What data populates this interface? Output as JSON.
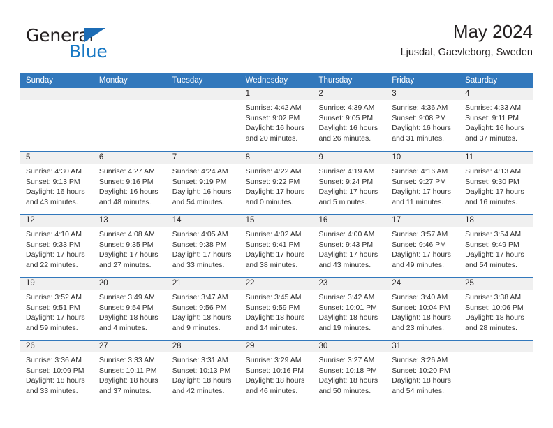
{
  "brand": {
    "name_part1": "General",
    "name_part2": "Blue",
    "triangle_color": "#1c6cb5",
    "blue_color": "#1878c4"
  },
  "header": {
    "title": "May 2024",
    "location": "Ljusdal, Gaevleborg, Sweden"
  },
  "theme": {
    "header_band": "#3278bc",
    "day_band": "#f0f0f0",
    "text": "#231f20"
  },
  "weekdays": [
    "Sunday",
    "Monday",
    "Tuesday",
    "Wednesday",
    "Thursday",
    "Friday",
    "Saturday"
  ],
  "weeks": [
    [
      {
        "day": "",
        "empty": true
      },
      {
        "day": "",
        "empty": true
      },
      {
        "day": "",
        "empty": true
      },
      {
        "day": "1",
        "sunrise": "Sunrise: 4:42 AM",
        "sunset": "Sunset: 9:02 PM",
        "daylight_line1": "Daylight: 16 hours",
        "daylight_line2": "and 20 minutes."
      },
      {
        "day": "2",
        "sunrise": "Sunrise: 4:39 AM",
        "sunset": "Sunset: 9:05 PM",
        "daylight_line1": "Daylight: 16 hours",
        "daylight_line2": "and 26 minutes."
      },
      {
        "day": "3",
        "sunrise": "Sunrise: 4:36 AM",
        "sunset": "Sunset: 9:08 PM",
        "daylight_line1": "Daylight: 16 hours",
        "daylight_line2": "and 31 minutes."
      },
      {
        "day": "4",
        "sunrise": "Sunrise: 4:33 AM",
        "sunset": "Sunset: 9:11 PM",
        "daylight_line1": "Daylight: 16 hours",
        "daylight_line2": "and 37 minutes."
      }
    ],
    [
      {
        "day": "5",
        "sunrise": "Sunrise: 4:30 AM",
        "sunset": "Sunset: 9:13 PM",
        "daylight_line1": "Daylight: 16 hours",
        "daylight_line2": "and 43 minutes."
      },
      {
        "day": "6",
        "sunrise": "Sunrise: 4:27 AM",
        "sunset": "Sunset: 9:16 PM",
        "daylight_line1": "Daylight: 16 hours",
        "daylight_line2": "and 48 minutes."
      },
      {
        "day": "7",
        "sunrise": "Sunrise: 4:24 AM",
        "sunset": "Sunset: 9:19 PM",
        "daylight_line1": "Daylight: 16 hours",
        "daylight_line2": "and 54 minutes."
      },
      {
        "day": "8",
        "sunrise": "Sunrise: 4:22 AM",
        "sunset": "Sunset: 9:22 PM",
        "daylight_line1": "Daylight: 17 hours",
        "daylight_line2": "and 0 minutes."
      },
      {
        "day": "9",
        "sunrise": "Sunrise: 4:19 AM",
        "sunset": "Sunset: 9:24 PM",
        "daylight_line1": "Daylight: 17 hours",
        "daylight_line2": "and 5 minutes."
      },
      {
        "day": "10",
        "sunrise": "Sunrise: 4:16 AM",
        "sunset": "Sunset: 9:27 PM",
        "daylight_line1": "Daylight: 17 hours",
        "daylight_line2": "and 11 minutes."
      },
      {
        "day": "11",
        "sunrise": "Sunrise: 4:13 AM",
        "sunset": "Sunset: 9:30 PM",
        "daylight_line1": "Daylight: 17 hours",
        "daylight_line2": "and 16 minutes."
      }
    ],
    [
      {
        "day": "12",
        "sunrise": "Sunrise: 4:10 AM",
        "sunset": "Sunset: 9:33 PM",
        "daylight_line1": "Daylight: 17 hours",
        "daylight_line2": "and 22 minutes."
      },
      {
        "day": "13",
        "sunrise": "Sunrise: 4:08 AM",
        "sunset": "Sunset: 9:35 PM",
        "daylight_line1": "Daylight: 17 hours",
        "daylight_line2": "and 27 minutes."
      },
      {
        "day": "14",
        "sunrise": "Sunrise: 4:05 AM",
        "sunset": "Sunset: 9:38 PM",
        "daylight_line1": "Daylight: 17 hours",
        "daylight_line2": "and 33 minutes."
      },
      {
        "day": "15",
        "sunrise": "Sunrise: 4:02 AM",
        "sunset": "Sunset: 9:41 PM",
        "daylight_line1": "Daylight: 17 hours",
        "daylight_line2": "and 38 minutes."
      },
      {
        "day": "16",
        "sunrise": "Sunrise: 4:00 AM",
        "sunset": "Sunset: 9:43 PM",
        "daylight_line1": "Daylight: 17 hours",
        "daylight_line2": "and 43 minutes."
      },
      {
        "day": "17",
        "sunrise": "Sunrise: 3:57 AM",
        "sunset": "Sunset: 9:46 PM",
        "daylight_line1": "Daylight: 17 hours",
        "daylight_line2": "and 49 minutes."
      },
      {
        "day": "18",
        "sunrise": "Sunrise: 3:54 AM",
        "sunset": "Sunset: 9:49 PM",
        "daylight_line1": "Daylight: 17 hours",
        "daylight_line2": "and 54 minutes."
      }
    ],
    [
      {
        "day": "19",
        "sunrise": "Sunrise: 3:52 AM",
        "sunset": "Sunset: 9:51 PM",
        "daylight_line1": "Daylight: 17 hours",
        "daylight_line2": "and 59 minutes."
      },
      {
        "day": "20",
        "sunrise": "Sunrise: 3:49 AM",
        "sunset": "Sunset: 9:54 PM",
        "daylight_line1": "Daylight: 18 hours",
        "daylight_line2": "and 4 minutes."
      },
      {
        "day": "21",
        "sunrise": "Sunrise: 3:47 AM",
        "sunset": "Sunset: 9:56 PM",
        "daylight_line1": "Daylight: 18 hours",
        "daylight_line2": "and 9 minutes."
      },
      {
        "day": "22",
        "sunrise": "Sunrise: 3:45 AM",
        "sunset": "Sunset: 9:59 PM",
        "daylight_line1": "Daylight: 18 hours",
        "daylight_line2": "and 14 minutes."
      },
      {
        "day": "23",
        "sunrise": "Sunrise: 3:42 AM",
        "sunset": "Sunset: 10:01 PM",
        "daylight_line1": "Daylight: 18 hours",
        "daylight_line2": "and 19 minutes."
      },
      {
        "day": "24",
        "sunrise": "Sunrise: 3:40 AM",
        "sunset": "Sunset: 10:04 PM",
        "daylight_line1": "Daylight: 18 hours",
        "daylight_line2": "and 23 minutes."
      },
      {
        "day": "25",
        "sunrise": "Sunrise: 3:38 AM",
        "sunset": "Sunset: 10:06 PM",
        "daylight_line1": "Daylight: 18 hours",
        "daylight_line2": "and 28 minutes."
      }
    ],
    [
      {
        "day": "26",
        "sunrise": "Sunrise: 3:36 AM",
        "sunset": "Sunset: 10:09 PM",
        "daylight_line1": "Daylight: 18 hours",
        "daylight_line2": "and 33 minutes."
      },
      {
        "day": "27",
        "sunrise": "Sunrise: 3:33 AM",
        "sunset": "Sunset: 10:11 PM",
        "daylight_line1": "Daylight: 18 hours",
        "daylight_line2": "and 37 minutes."
      },
      {
        "day": "28",
        "sunrise": "Sunrise: 3:31 AM",
        "sunset": "Sunset: 10:13 PM",
        "daylight_line1": "Daylight: 18 hours",
        "daylight_line2": "and 42 minutes."
      },
      {
        "day": "29",
        "sunrise": "Sunrise: 3:29 AM",
        "sunset": "Sunset: 10:16 PM",
        "daylight_line1": "Daylight: 18 hours",
        "daylight_line2": "and 46 minutes."
      },
      {
        "day": "30",
        "sunrise": "Sunrise: 3:27 AM",
        "sunset": "Sunset: 10:18 PM",
        "daylight_line1": "Daylight: 18 hours",
        "daylight_line2": "and 50 minutes."
      },
      {
        "day": "31",
        "sunrise": "Sunrise: 3:26 AM",
        "sunset": "Sunset: 10:20 PM",
        "daylight_line1": "Daylight: 18 hours",
        "daylight_line2": "and 54 minutes."
      },
      {
        "day": "",
        "empty": true
      }
    ]
  ]
}
